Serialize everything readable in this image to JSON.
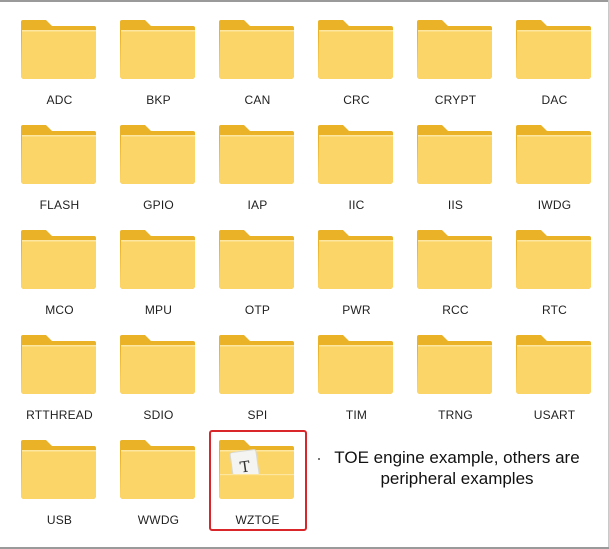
{
  "folders": [
    {
      "label": "ADC"
    },
    {
      "label": "BKP"
    },
    {
      "label": "CAN"
    },
    {
      "label": "CRC"
    },
    {
      "label": "CRYPT"
    },
    {
      "label": "DAC"
    },
    {
      "label": "FLASH"
    },
    {
      "label": "GPIO"
    },
    {
      "label": "IAP"
    },
    {
      "label": "IIC"
    },
    {
      "label": "IIS"
    },
    {
      "label": "IWDG"
    },
    {
      "label": "MCO"
    },
    {
      "label": "MPU"
    },
    {
      "label": "OTP"
    },
    {
      "label": "PWR"
    },
    {
      "label": "RCC"
    },
    {
      "label": "RTC"
    },
    {
      "label": "RTTHREAD"
    },
    {
      "label": "SDIO"
    },
    {
      "label": "SPI"
    },
    {
      "label": "TIM"
    },
    {
      "label": "TRNG"
    },
    {
      "label": "USART"
    },
    {
      "label": "USB"
    },
    {
      "label": "WWDG"
    },
    {
      "label": "WZTOE",
      "has_document": true,
      "document_glyph": "T",
      "highlighted": true
    }
  ],
  "annotation": {
    "line1": "TOE engine example, others are",
    "line2": "peripheral examples"
  },
  "colors": {
    "folder_back": "#e9b227",
    "folder_front": "#fcd568",
    "highlight_border": "#d9262b"
  },
  "icons": {
    "folder": "folder-icon",
    "document": "document-icon"
  }
}
